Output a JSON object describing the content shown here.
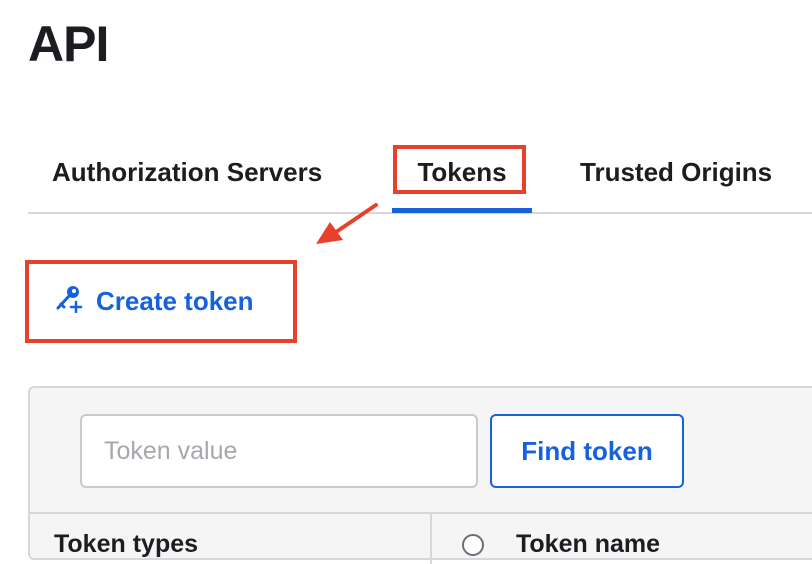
{
  "page": {
    "title": "API"
  },
  "tabs": [
    {
      "label": "Authorization Servers",
      "selected": false
    },
    {
      "label": "Tokens",
      "selected": true
    },
    {
      "label": "Trusted Origins",
      "selected": false
    }
  ],
  "actions": {
    "create_token_label": "Create token",
    "create_token_icon": "key-plus-icon"
  },
  "search": {
    "placeholder": "Token value",
    "value": "",
    "find_label": "Find token"
  },
  "table": {
    "filter_heading": "Token types",
    "columns": [
      "Token name"
    ]
  },
  "colors": {
    "accent": "#1662dd",
    "annotation": "#e8412b",
    "text": "#1d1d21"
  }
}
